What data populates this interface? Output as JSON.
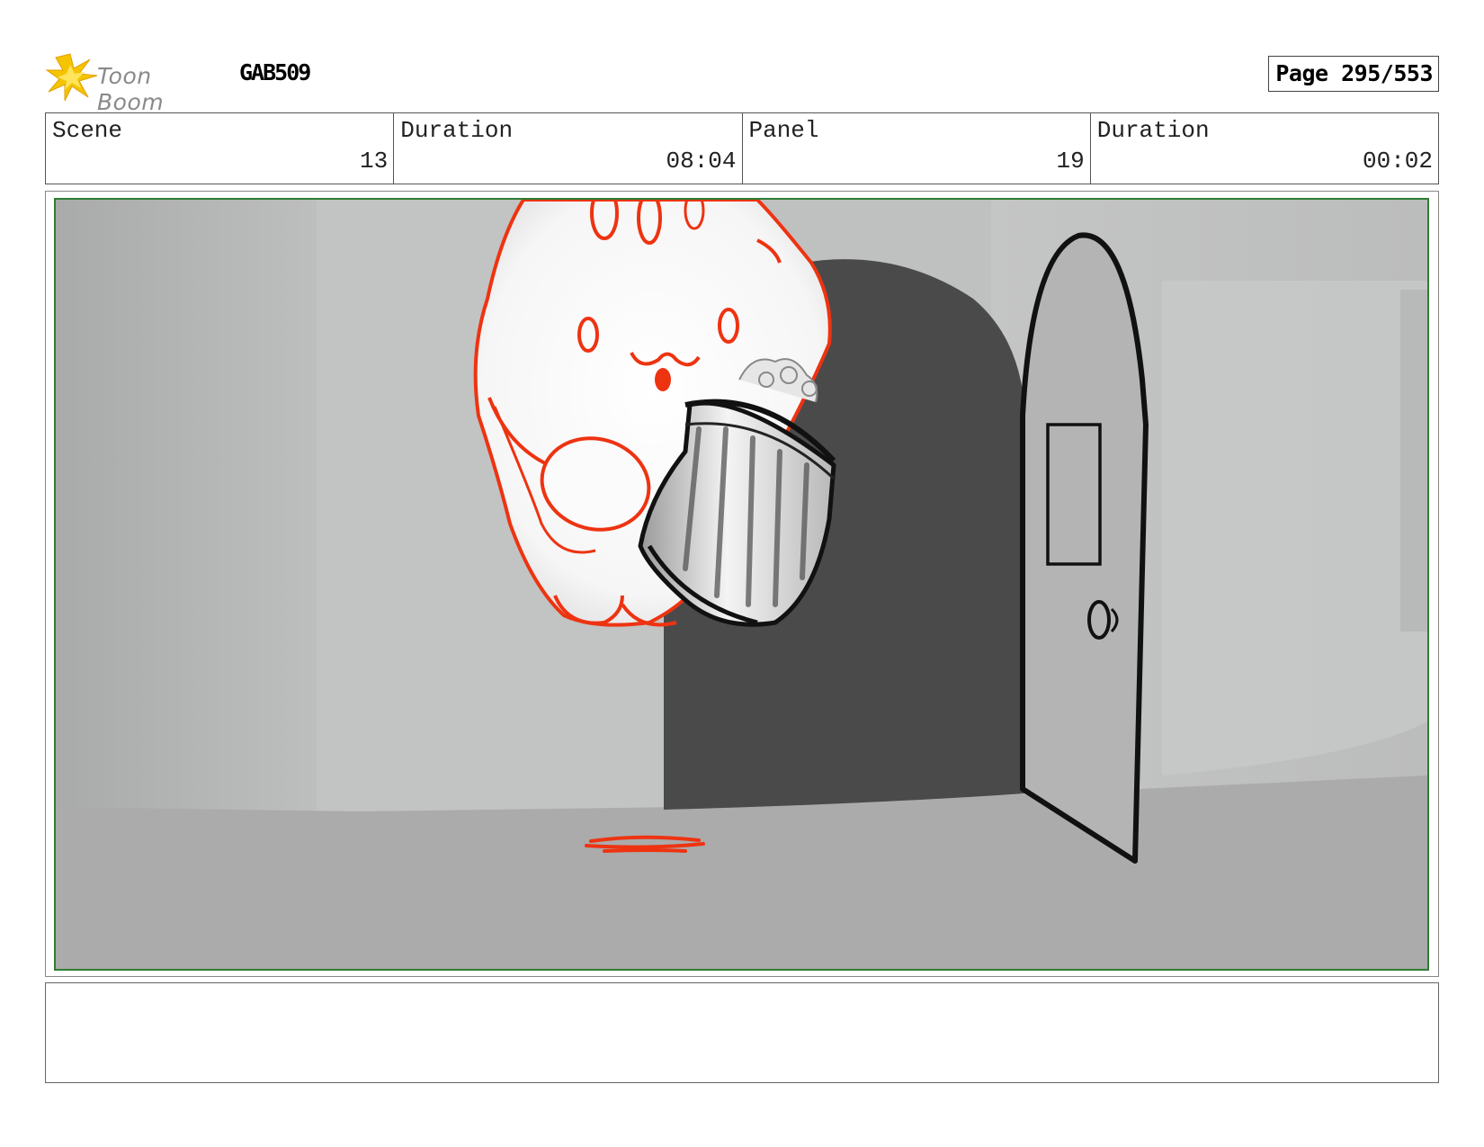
{
  "header": {
    "logo_text": "Toon Boom",
    "project_code": "GAB509",
    "page_label": "Page 295/553"
  },
  "info": [
    {
      "label": "Scene",
      "value": "13"
    },
    {
      "label": "Duration",
      "value": "08:04"
    },
    {
      "label": "Panel",
      "value": "19"
    },
    {
      "label": "Duration",
      "value": "00:02"
    }
  ],
  "colors": {
    "frame_green": "#2f7d32",
    "sketch_red": "#ee3311",
    "doorway_dark": "#4a4a4a"
  },
  "notes": ""
}
